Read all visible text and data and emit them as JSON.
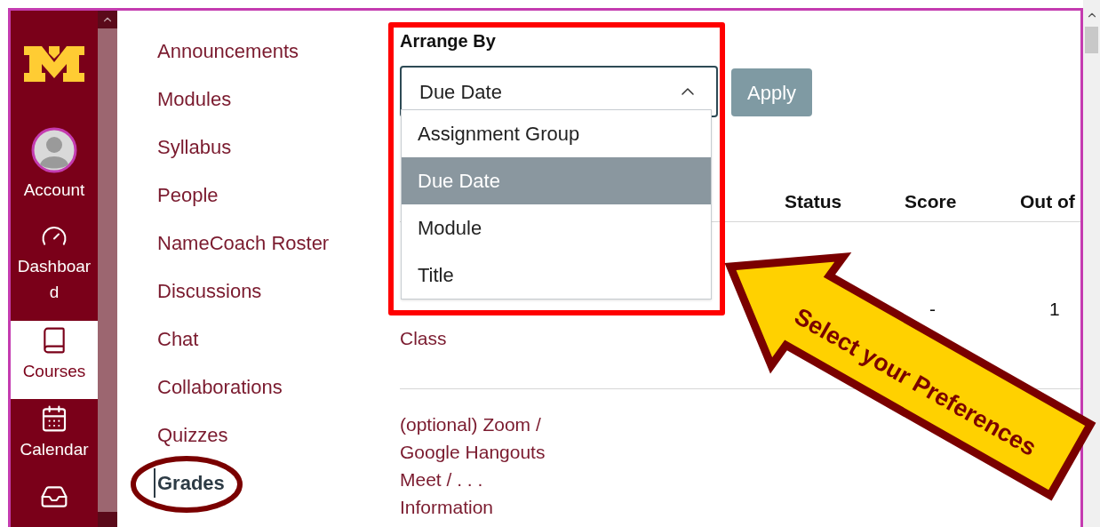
{
  "global_nav": {
    "items": [
      {
        "kind": "avatar",
        "label": "Account",
        "selected": false
      },
      {
        "kind": "dashboard",
        "label": "Dashboard",
        "selected": false
      },
      {
        "kind": "courses",
        "label": "Courses",
        "selected": true
      },
      {
        "kind": "calendar",
        "label": "Calendar",
        "selected": false
      },
      {
        "kind": "inbox",
        "selected": false
      }
    ]
  },
  "course_nav": {
    "items": [
      {
        "label": "Announcements",
        "selected": false
      },
      {
        "label": "Modules",
        "selected": false
      },
      {
        "label": "Syllabus",
        "selected": false
      },
      {
        "label": "People",
        "selected": false
      },
      {
        "label": "NameCoach Roster",
        "selected": false
      },
      {
        "label": "Discussions",
        "selected": false
      },
      {
        "label": "Chat",
        "selected": false
      },
      {
        "label": "Collaborations",
        "selected": false
      },
      {
        "label": "Quizzes",
        "selected": false
      },
      {
        "label": "Grades",
        "selected": true
      }
    ]
  },
  "arrange_by": {
    "label": "Arrange By",
    "select": {
      "value": "Due Date",
      "expanded": true
    },
    "options": [
      {
        "label": "Assignment Group",
        "selected": false
      },
      {
        "label": "Due Date",
        "selected": true
      },
      {
        "label": "Module",
        "selected": false
      },
      {
        "label": "Title",
        "selected": false
      }
    ],
    "apply_button": "Apply"
  },
  "table": {
    "columns": [
      "Status",
      "Score",
      "Out of"
    ],
    "rows": [
      {
        "title": "Class",
        "score": "-",
        "out_of": "1"
      },
      {
        "title": "(optional) Zoom / Google Hangouts Meet / . . . Information"
      }
    ]
  },
  "annotation": {
    "callout": "Select your Preferences"
  }
}
